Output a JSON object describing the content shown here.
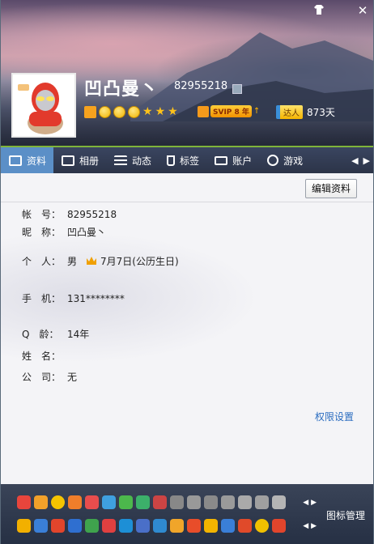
{
  "profile": {
    "nickname": "凹凸曼丶",
    "qq_number": "82955218",
    "online_days": "873天",
    "svip_label": "SVIP 8 年",
    "daren_label": "达人"
  },
  "window": {
    "skin_icon": "shirt-icon",
    "close_icon": "✕"
  },
  "tabs": [
    {
      "label": "资料"
    },
    {
      "label": "相册"
    },
    {
      "label": "动态"
    },
    {
      "label": "标签"
    },
    {
      "label": "账户"
    },
    {
      "label": "游戏"
    }
  ],
  "buttons": {
    "edit_profile": "编辑资料",
    "permissions": "权限设置",
    "icon_manager": "图标管理"
  },
  "fields": [
    {
      "key": "帐　号：",
      "value": "82955218"
    },
    {
      "key": "昵　称：",
      "value": "凹凸曼丶"
    },
    {
      "key": "个　人：",
      "value": "男",
      "extra": "7月7日(公历生日)"
    },
    {
      "key": "手　机：",
      "value": "131********"
    },
    {
      "key": "Q　龄：",
      "value": "14年"
    },
    {
      "key": "姓　名：",
      "value": ""
    },
    {
      "key": "公　司：",
      "value": "无"
    }
  ],
  "colors": {
    "accent": "#5b8fc7",
    "link": "#2a6cc0",
    "level_green": "#7fb43a"
  }
}
